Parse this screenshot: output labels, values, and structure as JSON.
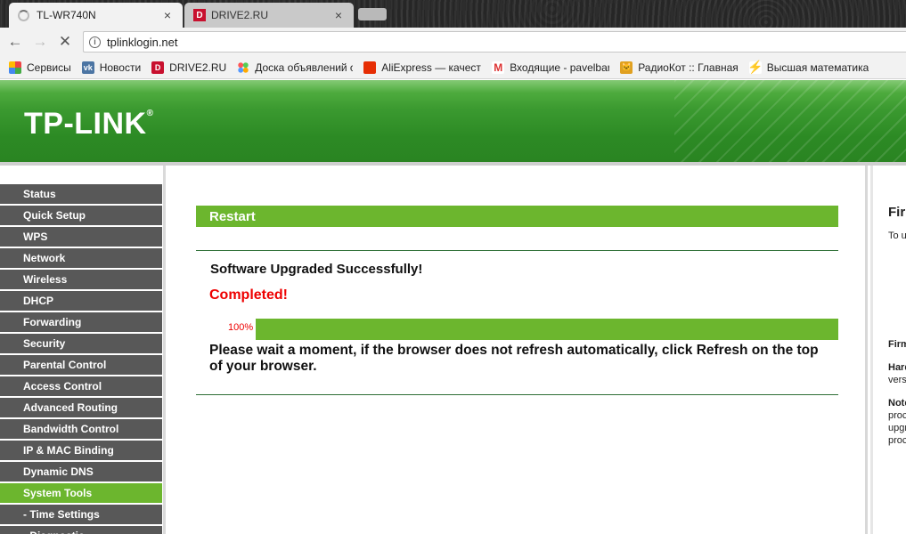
{
  "browser": {
    "tabs": [
      {
        "title": "TL-WR740N",
        "close": "×"
      },
      {
        "title": "DRIVE2.RU",
        "favicon_letter": "D",
        "close": "×"
      }
    ],
    "nav": {
      "back": "←",
      "forward": "→",
      "reload": "✕"
    },
    "address": {
      "info": "i",
      "url": "tplinklogin.net"
    },
    "bookmarks": [
      {
        "label": "Сервисы",
        "icon": "apps-icon"
      },
      {
        "label": "Новости",
        "icon": "vk-icon"
      },
      {
        "label": "DRIVE2.RU",
        "icon": "drive2-icon",
        "letter": "D"
      },
      {
        "label": "Доска объявлений с",
        "icon": "dots-icon"
      },
      {
        "label": "AliExpress — качеств",
        "icon": "aliexpress-icon"
      },
      {
        "label": "Входящие - pavelbar",
        "icon": "gmail-icon",
        "letter": "M"
      },
      {
        "label": "РадиоКот :: Главная",
        "icon": "cat-icon",
        "letter": "🐱"
      },
      {
        "label": "Высшая математика",
        "icon": "bolt-icon",
        "letter": "⚡"
      }
    ]
  },
  "brand": {
    "name": "TP-LINK",
    "mark": "®"
  },
  "menu": [
    {
      "label": "Status"
    },
    {
      "label": "Quick Setup"
    },
    {
      "label": "WPS"
    },
    {
      "label": "Network"
    },
    {
      "label": "Wireless"
    },
    {
      "label": "DHCP"
    },
    {
      "label": "Forwarding"
    },
    {
      "label": "Security"
    },
    {
      "label": "Parental Control"
    },
    {
      "label": "Access Control"
    },
    {
      "label": "Advanced Routing"
    },
    {
      "label": "Bandwidth Control"
    },
    {
      "label": "IP & MAC Binding"
    },
    {
      "label": "Dynamic DNS"
    },
    {
      "label": "System Tools",
      "active": true
    },
    {
      "label": "- Time Settings"
    },
    {
      "label": "- Diagnostic"
    }
  ],
  "content": {
    "section_title": "Restart",
    "success": "Software Upgraded Successfully!",
    "status": "Completed!",
    "progress": {
      "value": 100,
      "label": "100%"
    },
    "message": "Please wait a moment, if the browser does not refresh automatically, click Refresh on the top of your browser."
  },
  "help": {
    "title": "Firı",
    "line1": "To u",
    "line2": "Firm",
    "line3": "Hard",
    "line4": "vers",
    "line5": "Note",
    "line6": "proc",
    "line7": "upgr",
    "line8": "proc"
  },
  "colors": {
    "brand_green": "#2c8a24",
    "accent_green": "#6cb62e",
    "menu_gray": "#585858",
    "alert_red": "#e00000"
  }
}
